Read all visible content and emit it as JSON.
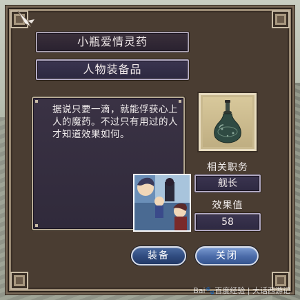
{
  "item": {
    "name": "小瓶爱情灵药",
    "category": "人物装备品",
    "description": "据说只要一滴，就能俘获心上人的魔药。不过只有用过的人才知道效果如何。",
    "icon": "potion-bottle-icon"
  },
  "stats": {
    "role_label": "相关职务",
    "role_value": "舰长",
    "effect_label": "效果值",
    "effect_value": "58"
  },
  "buttons": {
    "equip": "装备",
    "close": "关闭"
  },
  "watermark": "Bai🐾百度经验 | 大话西游记"
}
